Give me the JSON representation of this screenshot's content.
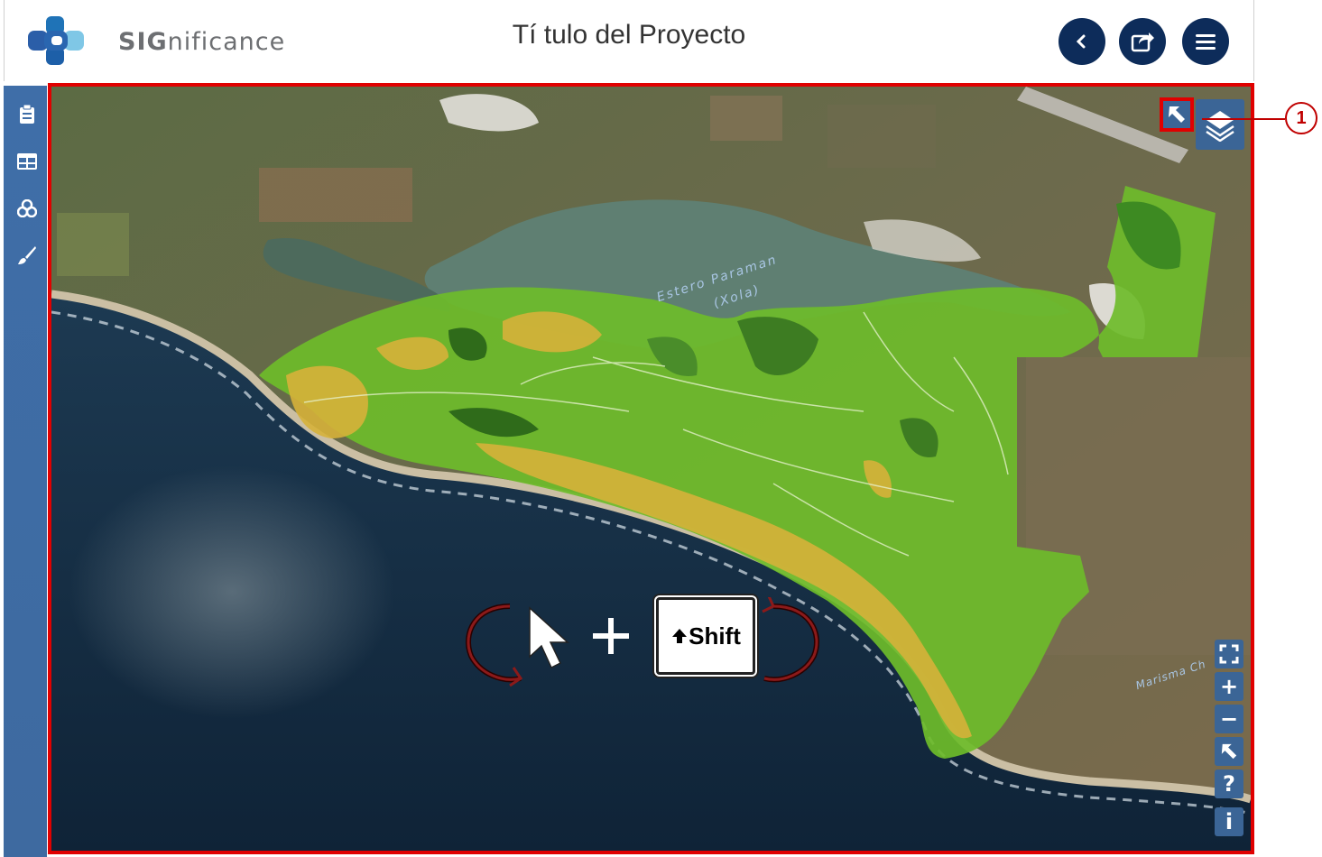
{
  "brand": {
    "name_bold": "SIG",
    "name_rest": "nificance"
  },
  "header": {
    "title": "Tí tulo del Proyecto"
  },
  "header_buttons": [
    {
      "icon": "chevron-left-icon"
    },
    {
      "icon": "share-icon"
    },
    {
      "icon": "menu-icon"
    }
  ],
  "sidebar": {
    "icons": [
      "clipboard-icon",
      "table-icon",
      "layers-cluster-icon",
      "brush-icon"
    ]
  },
  "map": {
    "labels": {
      "estero_line1": "Estero Paraman",
      "estero_line2": "(Xola)",
      "marisma": "Marisma Ch"
    },
    "shift_key_label": "Shift",
    "right_controls": [
      "fullscreen-icon",
      "zoom-in-icon",
      "zoom-out-icon",
      "reset-north-icon",
      "help-icon",
      "info-icon"
    ],
    "right_glyphs": {
      "zoom_in": "+",
      "zoom_out": "−",
      "help": "?",
      "info": "i"
    }
  },
  "annotation": {
    "number": "1"
  },
  "colors": {
    "header_button": "#0d2c5a",
    "sidebar": "#3e6aa0",
    "highlight": "#e00000",
    "vegetation": "#6dbb2a",
    "sand_zone": "#d6b13a"
  }
}
